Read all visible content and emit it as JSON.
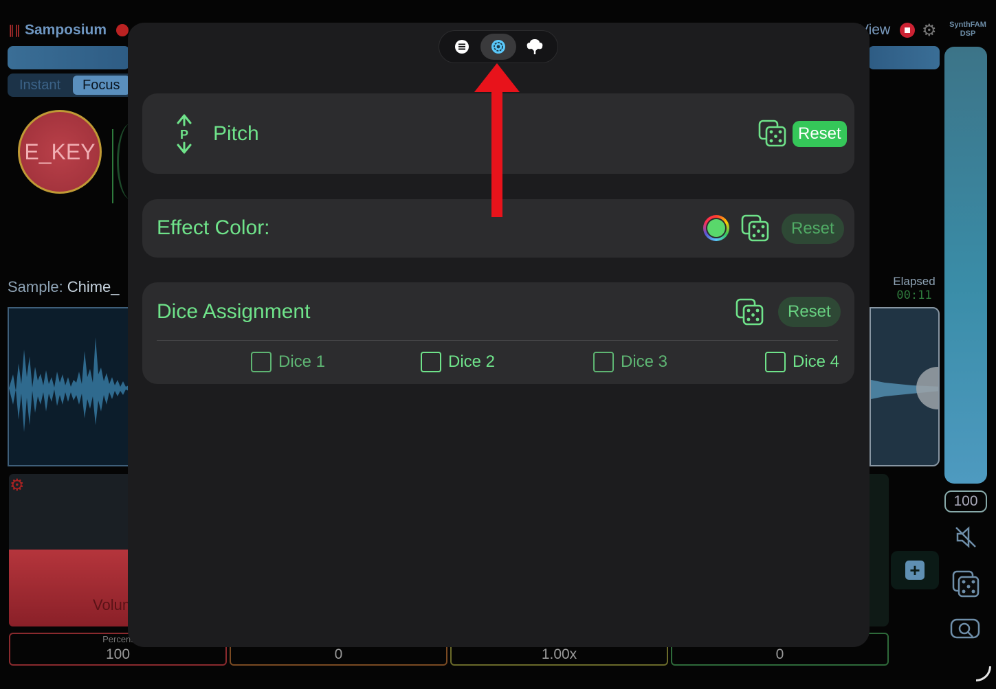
{
  "app": {
    "title": "Samposium",
    "segments": [
      "Instant",
      "Focus"
    ],
    "key_label": "E_KEY",
    "sample_label": "Sample:",
    "sample_name": "Chime_",
    "view_label": "View",
    "logo_line1": "SynthFAM",
    "logo_line2": "DSP",
    "elapsed_label": "Elapsed",
    "elapsed_time": "00:11",
    "volume_label": "Volum",
    "bottom_caption": "Percent",
    "bottom_values": [
      "100",
      "0",
      "1.00x",
      "0"
    ],
    "master_value": "100",
    "colors": {
      "accent_blue": "#5a8fbd",
      "record_red": "#cc2233",
      "volume_red": "#b5353c"
    }
  },
  "modal": {
    "tabs": [
      {
        "icon": "list-icon",
        "active": false
      },
      {
        "icon": "settings-icon",
        "active": true
      },
      {
        "icon": "tree-icon",
        "active": false
      }
    ],
    "pitch_card": {
      "title": "Pitch",
      "icon_letter": "P",
      "reset_label": "Reset"
    },
    "effect_card": {
      "title": "Effect Color:",
      "swatch_color": "#59d86b",
      "reset_label": "Reset"
    },
    "dice_card": {
      "title": "Dice Assignment",
      "reset_label": "Reset",
      "options": [
        {
          "label": "Dice 1",
          "checked": false
        },
        {
          "label": "Dice 2",
          "checked": false
        },
        {
          "label": "Dice 3",
          "checked": false
        },
        {
          "label": "Dice 4",
          "checked": false
        }
      ]
    },
    "colors": {
      "green": "#6fe38a",
      "reset_solid": "#35c759",
      "annotation_arrow": "#e8131b"
    }
  }
}
